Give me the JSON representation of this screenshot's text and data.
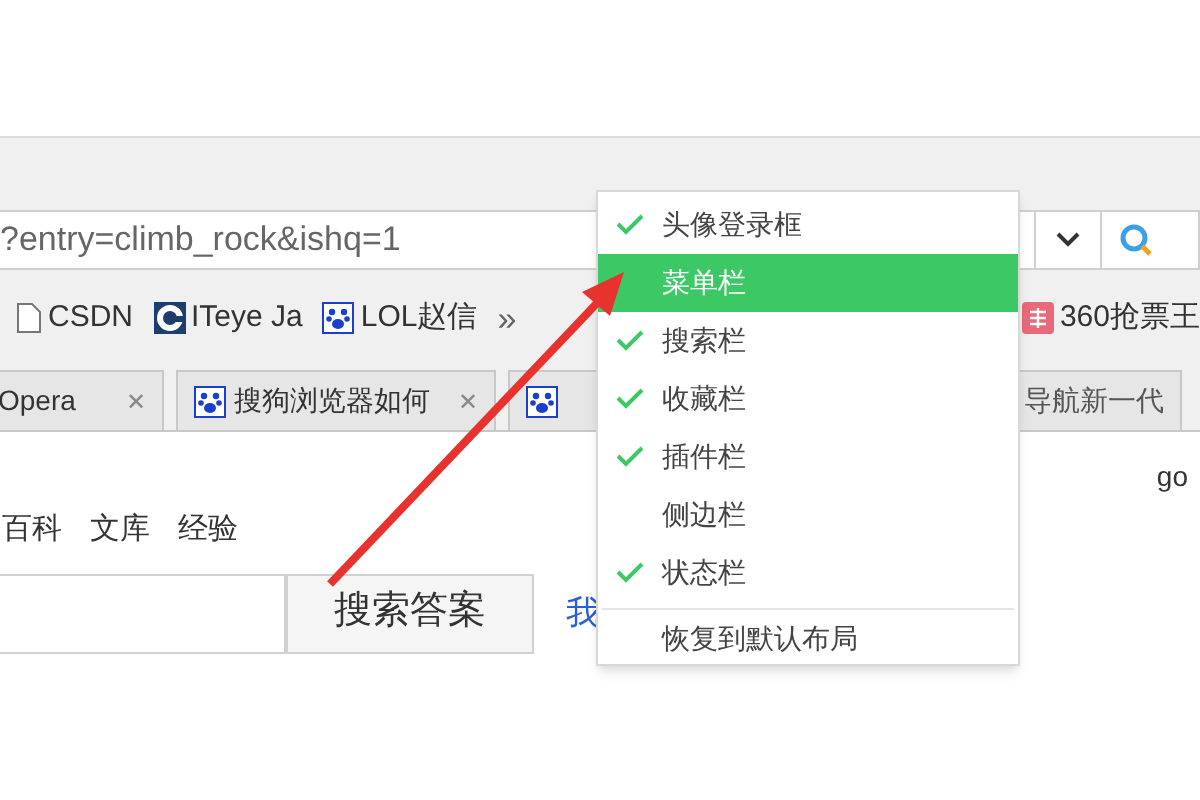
{
  "address_bar": {
    "url": "?entry=climb_rock&ishq=1"
  },
  "bookmarks": [
    {
      "label": "CSDN",
      "kind": "page"
    },
    {
      "label": "ITeye Ja",
      "kind": "logo"
    },
    {
      "label": "LOL赵信",
      "kind": "paw"
    }
  ],
  "bookmarks_more": "»",
  "bookmarks_right": [
    {
      "label": "360抢票王",
      "kind": "ticket"
    }
  ],
  "tabs": [
    {
      "label": "Opera",
      "kind": "plain",
      "close": "✕"
    },
    {
      "label": "搜狗浏览器如何",
      "kind": "paw",
      "close": "✕"
    },
    {
      "label": "导航新一代",
      "kind": "paw"
    }
  ],
  "page": {
    "right_text": "go",
    "links": [
      "百科",
      "文库",
      "经验"
    ],
    "search_button": "搜索答案",
    "side_link": "我"
  },
  "menu": {
    "items": [
      {
        "label": "头像登录框",
        "checked": true,
        "selected": false
      },
      {
        "label": "菜单栏",
        "checked": false,
        "selected": true
      },
      {
        "label": "搜索栏",
        "checked": true,
        "selected": false
      },
      {
        "label": "收藏栏",
        "checked": true,
        "selected": false
      },
      {
        "label": "插件栏",
        "checked": true,
        "selected": false
      },
      {
        "label": "侧边栏",
        "checked": false,
        "selected": false
      },
      {
        "label": "状态栏",
        "checked": true,
        "selected": false
      }
    ],
    "reset": "恢复到默认布局"
  }
}
